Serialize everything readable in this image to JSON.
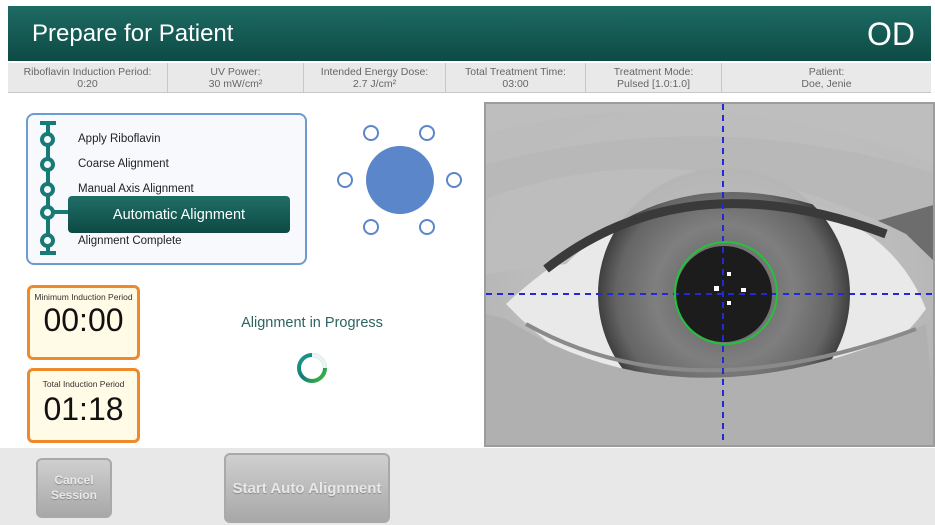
{
  "header": {
    "title": "Prepare for Patient",
    "eye": "OD"
  },
  "info_bar": [
    {
      "label": "Riboflavin Induction Period:",
      "value": "0:20"
    },
    {
      "label": "UV Power:",
      "value": "30 mW/cm²"
    },
    {
      "label": "Intended Energy Dose:",
      "value": "2.7 J/cm²"
    },
    {
      "label": "Total Treatment Time:",
      "value": "03:00"
    },
    {
      "label": "Treatment Mode:",
      "value": "Pulsed [1.0:1.0]"
    },
    {
      "label": "Patient:",
      "value": "Doe, Jenie"
    }
  ],
  "steps": [
    {
      "label": "Apply Riboflavin"
    },
    {
      "label": "Coarse Alignment"
    },
    {
      "label": "Manual Axis Alignment"
    },
    {
      "label": "Automatic Alignment",
      "active": true
    },
    {
      "label": "Alignment Complete"
    }
  ],
  "timers": {
    "minimum": {
      "label": "Minimum Induction Period",
      "value": "00:00"
    },
    "total": {
      "label": "Total Induction Period",
      "value": "01:18"
    }
  },
  "status": {
    "text": "Alignment in Progress"
  },
  "buttons": {
    "cancel": "Cancel Session",
    "start": "Start Auto Alignment"
  },
  "colors": {
    "header": "#0e4a45",
    "accent_teal": "#167a75",
    "timer_border": "#ef8a2c",
    "led_fill": "#5b86c9",
    "reticle": "#1f2bd6",
    "pupil_ring": "#22c33a"
  }
}
